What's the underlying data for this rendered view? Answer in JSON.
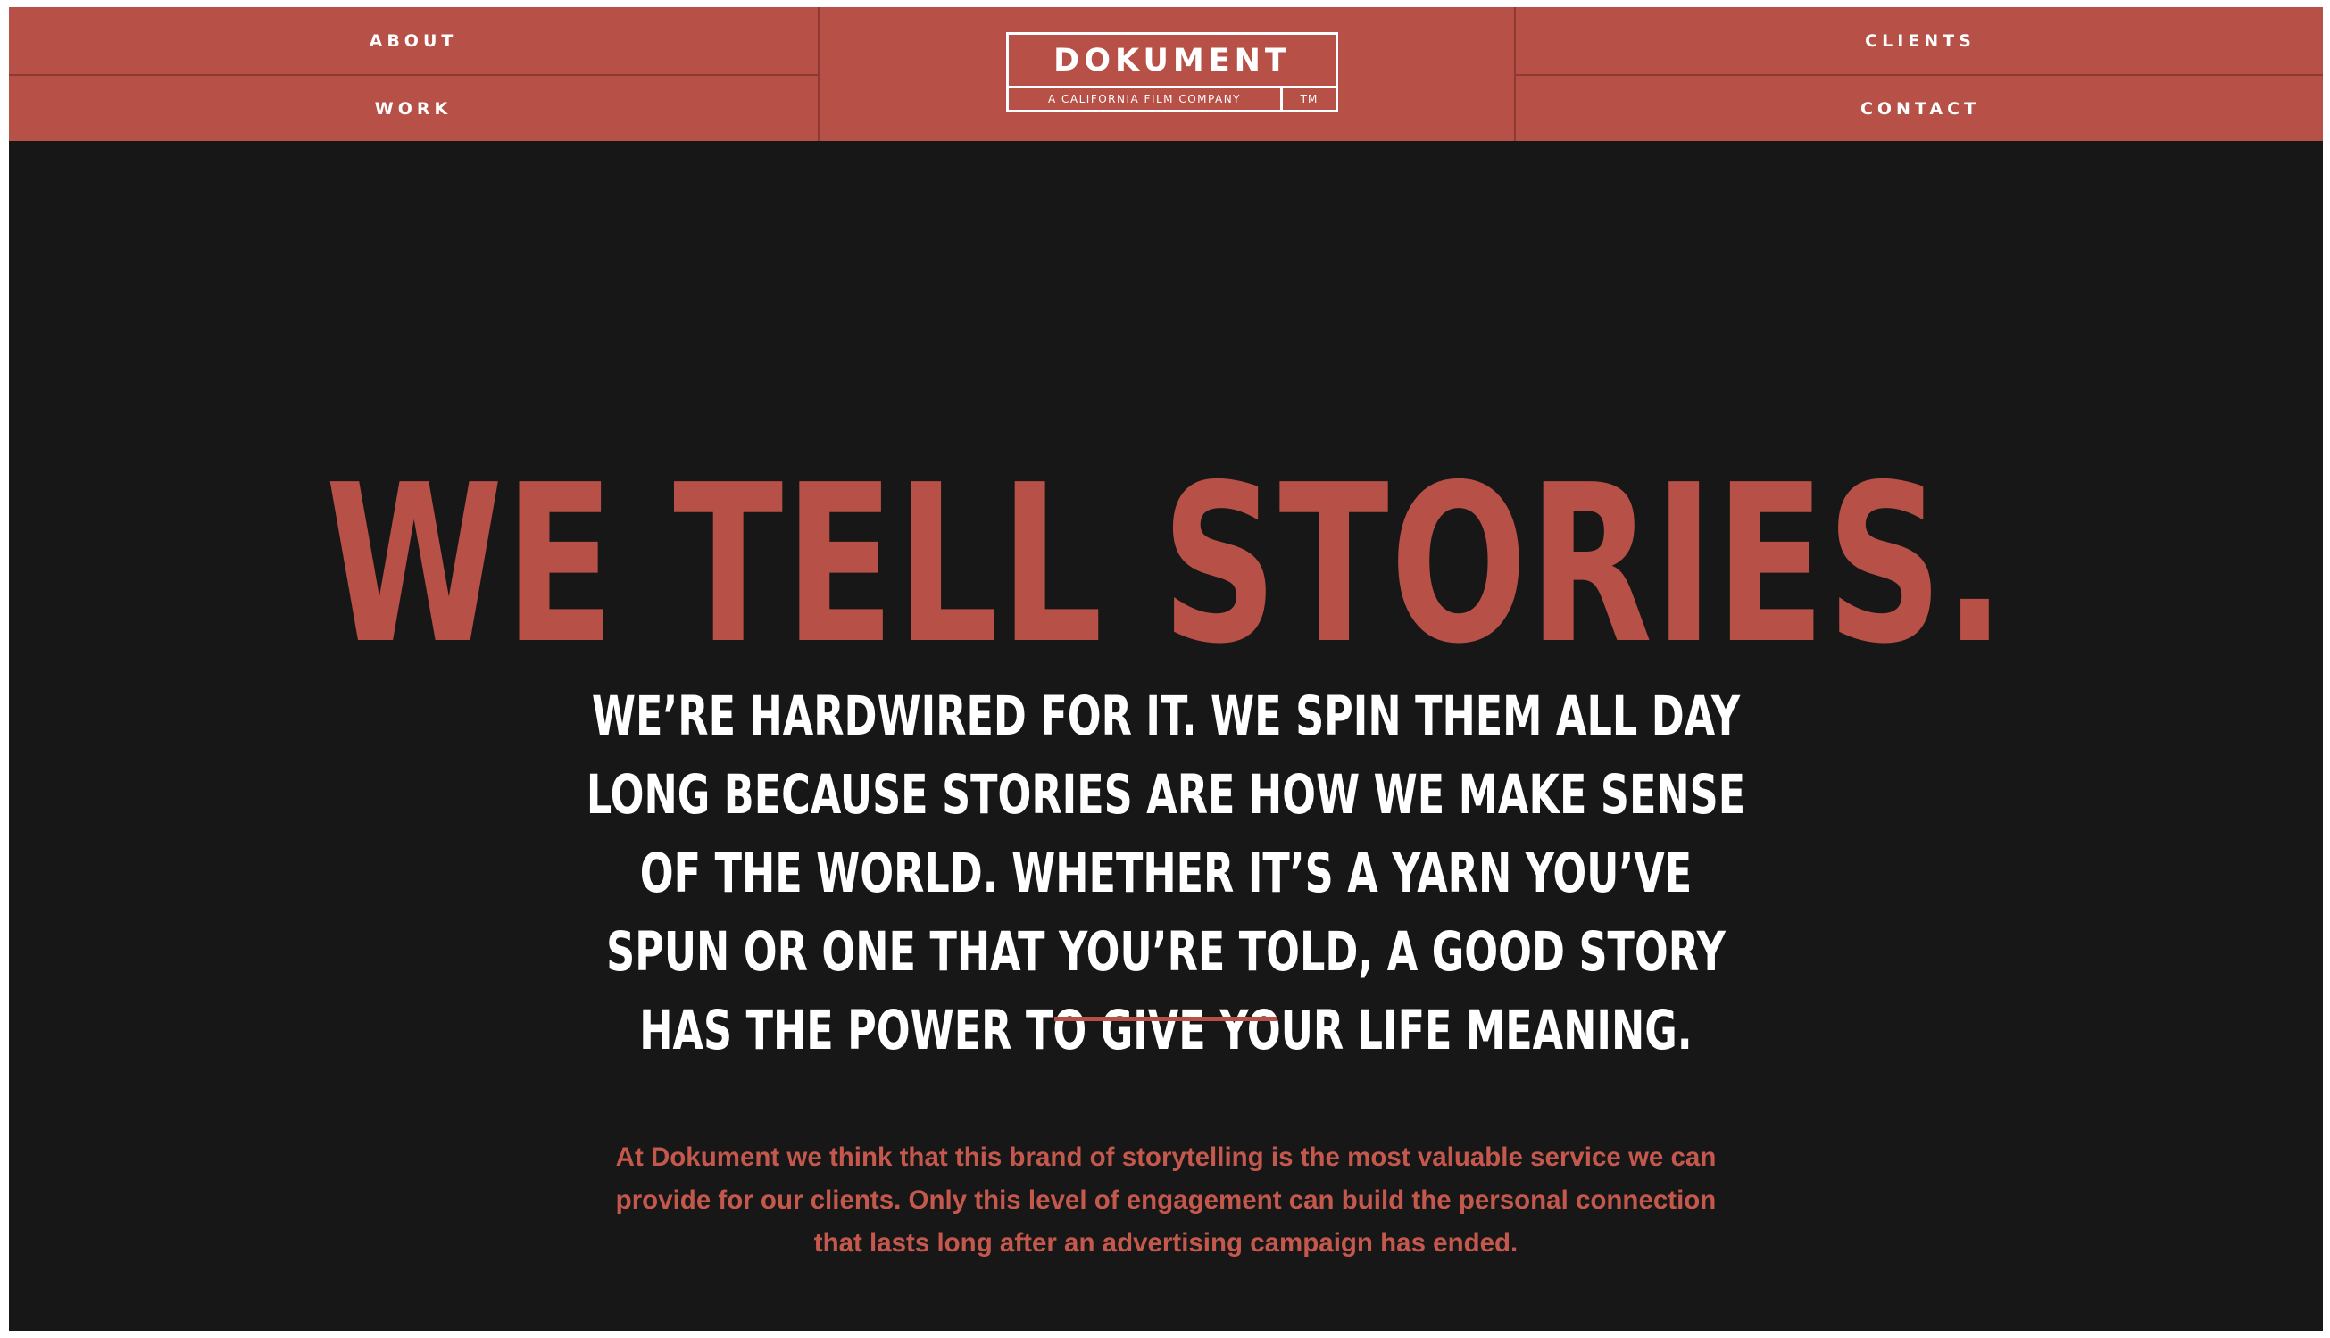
{
  "nav": {
    "about_label": "ABOUT",
    "work_label": "WORK",
    "clients_label": "CLIENTS",
    "contact_label": "CONTACT"
  },
  "logo": {
    "name": "DOKUMENT",
    "tagline": "A CALIFORNIA FILM COMPANY",
    "trademark": "TM"
  },
  "hero": {
    "headline": "WE TELL STORIES.",
    "subhead": "WE’RE HARDWIRED FOR IT. WE SPIN THEM ALL DAY LONG BECAUSE STORIES ARE HOW WE MAKE SENSE OF THE WORLD. WHETHER IT’S A YARN YOU’VE SPUN OR ONE THAT YOU’RE TOLD, A GOOD STORY HAS THE POWER TO GIVE YOUR LIFE MEANING.",
    "body": "At Dokument we think that this brand of storytelling is the most valuable service we can provide for our clients. Only this level of engagement can build the personal connection that lasts long after an advertising campaign has ended."
  },
  "colors": {
    "brand_red": "#b75047",
    "background": "#171717",
    "text_light": "#ffffff",
    "body_text": "#c4584d"
  }
}
